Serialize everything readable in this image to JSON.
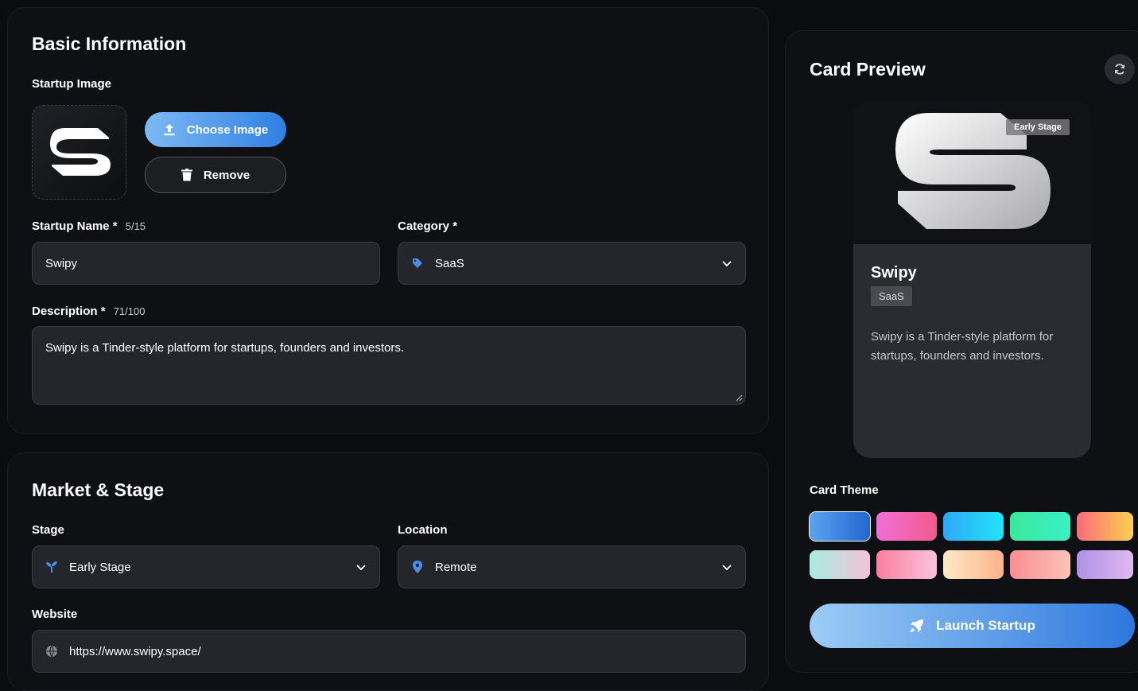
{
  "basic": {
    "title": "Basic Information",
    "image_label": "Startup Image",
    "choose_label": "Choose Image",
    "remove_label": "Remove",
    "name_label": "Startup Name",
    "name_count": "5/15",
    "name_value": "Swipy",
    "category_label": "Category",
    "category_value": "SaaS",
    "desc_label": "Description",
    "desc_count": "71/100",
    "desc_value": "Swipy is a Tinder-style platform for startups, founders and investors.",
    "required_mark": "*"
  },
  "market": {
    "title": "Market & Stage",
    "stage_label": "Stage",
    "stage_value": "Early Stage",
    "location_label": "Location",
    "location_value": "Remote",
    "website_label": "Website",
    "website_value": "https://www.swipy.space/"
  },
  "preview": {
    "title": "Card Preview",
    "badge": "Early Stage",
    "name": "Swipy",
    "tag": "SaaS",
    "desc": "Swipy is a Tinder-style platform for startups, founders and investors.",
    "theme_label": "Card Theme",
    "launch_label": "Launch Startup"
  },
  "themes": [
    {
      "name": "blue",
      "from": "#5ba3ee",
      "to": "#2466d0"
    },
    {
      "name": "pink-magenta",
      "from": "#f06fd6",
      "to": "#f25a8c"
    },
    {
      "name": "cyan",
      "from": "#2ea8f6",
      "to": "#22e4f8"
    },
    {
      "name": "green",
      "from": "#3ae89b",
      "to": "#3af0c6"
    },
    {
      "name": "orange",
      "from": "#fb6b7a",
      "to": "#fbd14f"
    },
    {
      "name": "mint-pink",
      "from": "#a7ecde",
      "to": "#f5c2d8"
    },
    {
      "name": "rose",
      "from": "#fb7ea0",
      "to": "#f9c3dd"
    },
    {
      "name": "peach",
      "from": "#fde9c7",
      "to": "#fbb38a"
    },
    {
      "name": "salmon",
      "from": "#fb8e93",
      "to": "#fbc3b5"
    },
    {
      "name": "lavender",
      "from": "#ae91e6",
      "to": "#e0b9ef"
    }
  ],
  "colors": {
    "accent": "#4a90e2",
    "pin": "#4b8de8",
    "panel": "#0f1014",
    "field": "#25262b"
  }
}
